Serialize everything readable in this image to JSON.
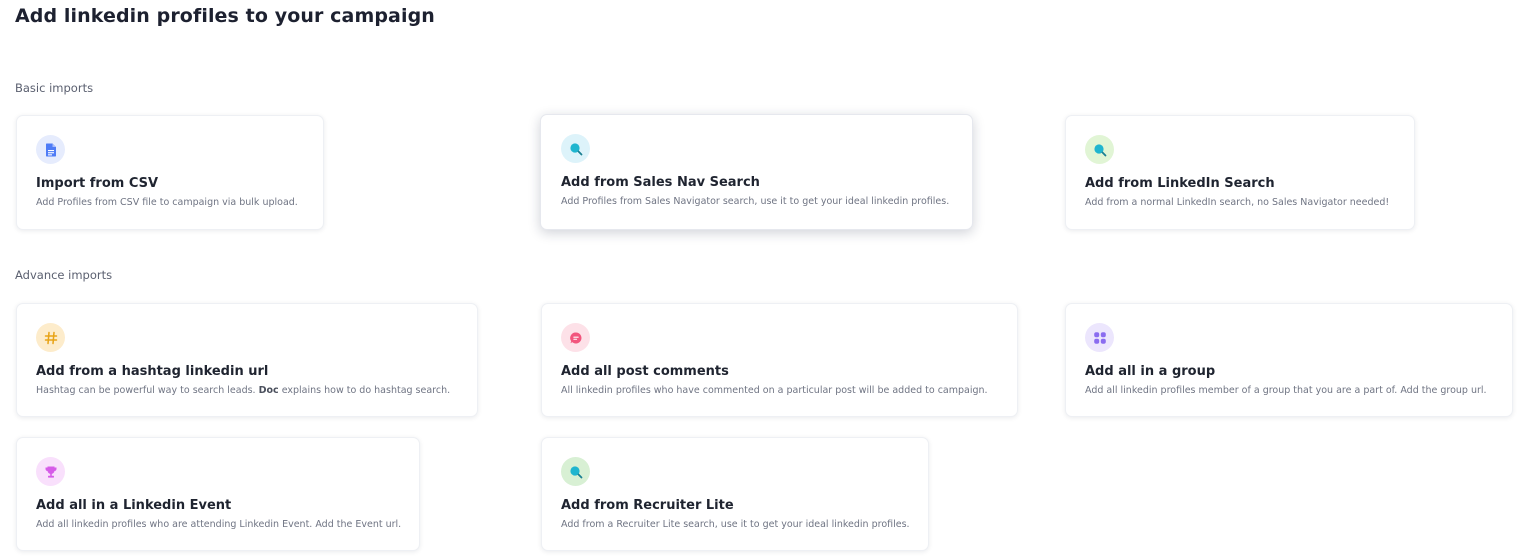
{
  "page": {
    "title": "Add linkedin profiles to your campaign"
  },
  "sections": {
    "basic_label": "Basic imports",
    "advance_label": "Advance imports"
  },
  "cards": {
    "csv": {
      "title": "Import from CSV",
      "desc": "Add Profiles from CSV file to campaign via bulk upload.",
      "icon": "document-icon",
      "icon_color": "#4f7cf6",
      "badge_color": "#e6ecfd"
    },
    "sales_nav": {
      "title": "Add from Sales Nav Search",
      "desc": "Add Profiles from Sales Navigator search, use it to get your ideal linkedin profiles.",
      "icon": "search-icon",
      "icon_color": "#1fb5cf",
      "badge_color": "#ddf3fa"
    },
    "linkedin_search": {
      "title": "Add from LinkedIn Search",
      "desc": "Add from a normal LinkedIn search, no Sales Navigator needed!",
      "icon": "search-icon",
      "icon_color": "#1fb5cf",
      "badge_color": "#e1f5d5"
    },
    "hashtag": {
      "title": "Add from a hashtag linkedin url",
      "desc_before": "Hashtag can be powerful way to search leads.",
      "desc_link": "Doc",
      "desc_after": "explains how to do hashtag search.",
      "icon": "hashtag-icon",
      "icon_color": "#e8a317",
      "badge_color": "#fdeccb"
    },
    "post_comments": {
      "title": "Add all post comments",
      "desc": "All linkedin profiles who have commented on a particular post will be added to campaign.",
      "icon": "comment-icon",
      "icon_color": "#f2557d",
      "badge_color": "#fde1e8"
    },
    "group": {
      "title": "Add all in a group",
      "desc": "Add all linkedin profiles member of a group that you are a part of. Add the group url.",
      "icon": "grid-icon",
      "icon_color": "#8a6cf0",
      "badge_color": "#ece6fd"
    },
    "event": {
      "title": "Add all in a Linkedin Event",
      "desc": "Add all linkedin profiles who are attending Linkedin Event. Add the Event url.",
      "icon": "trophy-icon",
      "icon_color": "#d65be8",
      "badge_color": "#f9e0fc"
    },
    "recruiter": {
      "title": "Add from Recruiter Lite",
      "desc": "Add from a Recruiter Lite search, use it to get your ideal linkedin profiles.",
      "icon": "search-icon",
      "icon_color": "#1fb5cf",
      "badge_color": "#d8f0d4"
    }
  }
}
